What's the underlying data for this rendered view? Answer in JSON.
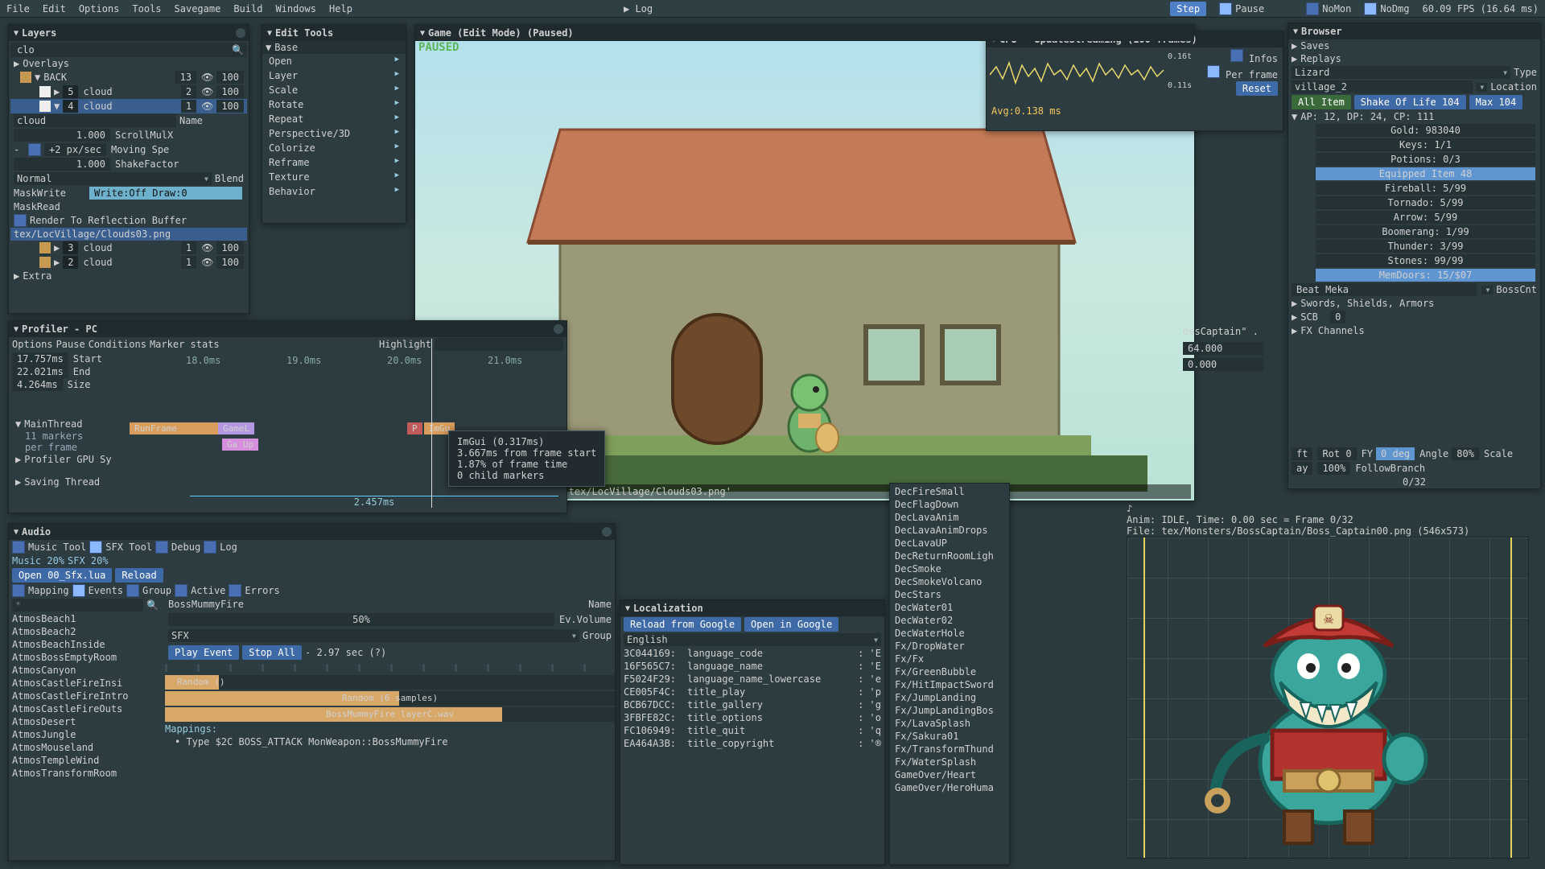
{
  "menubar": {
    "items": [
      "File",
      "Edit",
      "Options",
      "Tools",
      "Savegame",
      "Build",
      "Windows",
      "Help"
    ],
    "log": "Log",
    "step": "Step",
    "pause": "Pause",
    "nomon": "NoMon",
    "nodmg": "NoDmg",
    "fps": "60.09 FPS (16.64 ms)"
  },
  "layers": {
    "title": "Layers",
    "search": "clo",
    "overlays": "Overlays",
    "back": "BACK",
    "back_n": "13",
    "back_v": "100",
    "rows": [
      {
        "n": "5",
        "name": "cloud",
        "a": "2",
        "v": "100"
      },
      {
        "n": "4",
        "name": "cloud",
        "a": "1",
        "v": "100"
      }
    ],
    "picked": "cloud",
    "nameh": "Name",
    "sx_v": "1.000",
    "sx_l": "ScrollMulX",
    "spd_v": "+2 px/sec",
    "spd_l": "Moving Spe",
    "sk_v": "1.000",
    "sk_l": "ShakeFactor",
    "blend_mode": "Normal",
    "blend_l": "Blend",
    "maskw": "MaskWrite",
    "maskw_v": "Write:Off Draw:0",
    "maskr": "MaskRead",
    "reflect": "Render To Reflection Buffer",
    "path": "tex/LocVillage/Clouds03.png",
    "rows2": [
      {
        "n": "3",
        "name": "cloud",
        "a": "1",
        "v": "100"
      },
      {
        "n": "2",
        "name": "cloud",
        "a": "1",
        "v": "100"
      }
    ],
    "extra": "Extra"
  },
  "edit_tools": {
    "title": "Edit Tools",
    "base": "Base",
    "items": [
      "Open",
      "Layer",
      "Scale",
      "Rotate",
      "Repeat",
      "Perspective/3D",
      "Colorize",
      "Reframe",
      "Texture",
      "Behavior"
    ]
  },
  "game": {
    "title": "Game (Edit Mode) (Paused)",
    "paused": "PAUSED",
    "status": "Select layer:BG layer 4 'tex/LocVillage/Clouds03.png'"
  },
  "cpu": {
    "title": "CPU - UpdateStreaming (100 frames)",
    "t0": "0.16t",
    "t1": "0.11s",
    "infos": "Infos",
    "perframe": "Per frame",
    "reset": "Reset",
    "avg": "Avg:0.138 ms"
  },
  "profiler": {
    "title": "Profiler - PC",
    "menu": [
      "Options",
      "Pause",
      "Conditions",
      "Marker stats"
    ],
    "hl": "Highlight",
    "start_v": "17.757ms",
    "start_l": "Start",
    "end_v": "22.021ms",
    "end_l": "End",
    "size_v": "4.264ms",
    "size_l": "Size",
    "ticks": [
      "18.0ms",
      "19.0ms",
      "20.0ms",
      "21.0ms"
    ],
    "main": "MainThread",
    "main_sub": "11 markers\nper frame",
    "gpu": "Profiler GPU Sy",
    "saving": "Saving Thread",
    "bars": [
      "RunFrame",
      "GameL",
      "Ga Up",
      "P",
      "ImGu"
    ],
    "ruler": "2.457ms",
    "tooltip": [
      "ImGui (0.317ms)",
      "3.667ms from frame start",
      "1.87% of frame time",
      "0 child markers"
    ]
  },
  "audio": {
    "title": "Audio",
    "tabs": [
      "Music Tool",
      "SFX Tool",
      "Debug",
      "Log"
    ],
    "music": "Music 20%",
    "sfx": "SFX 20%",
    "open": "Open 00_Sfx.lua",
    "reload": "Reload",
    "filters": [
      "Mapping",
      "Events",
      "Group",
      "Active",
      "Errors"
    ],
    "search_ph": "*",
    "namecol": "Name",
    "name": "BossMummyFire",
    "fifty": "50%",
    "evvol": "Ev.Volume",
    "sfx_lbl": "SFX",
    "group": "Group",
    "play": "Play Event",
    "stop": "Stop All",
    "dur": "- 2.97 sec (?)",
    "rand": "Random ()",
    "rand2": "Random (6 samples)",
    "wav": "BossMummyFire layerC.wav",
    "mappings": "Mappings:",
    "map1": "• Type $2C BOSS_ATTACK    MonWeapon::BossMummyFire",
    "list": [
      "AtmosBeach1",
      "AtmosBeach2",
      "AtmosBeachInside",
      "AtmosBossEmptyRoom",
      "AtmosCanyon",
      "AtmosCastleFireInsi",
      "AtmosCastleFireIntro",
      "AtmosCastleFireOuts",
      "AtmosDesert",
      "AtmosJungle",
      "AtmosMouseland",
      "AtmosTempleWind",
      "AtmosTransformRoom"
    ]
  },
  "loc": {
    "title": "Localization",
    "reload": "Reload from Google",
    "open": "Open in Google",
    "lang": "English",
    "rows": [
      [
        "3C044169:",
        "language_code",
        ": 'E"
      ],
      [
        "16F565C7:",
        "language_name",
        ": 'E"
      ],
      [
        "F5024F29:",
        "language_name_lowercase",
        ": 'e"
      ],
      [
        "CE005F4C:",
        "title_play",
        ": 'p"
      ],
      [
        "BCB67DCC:",
        "title_gallery",
        ": 'g"
      ],
      [
        "3FBFE82C:",
        "title_options",
        ": 'o"
      ],
      [
        "FC106949:",
        "title_quit",
        ": 'q"
      ],
      [
        "EA464A3B:",
        "title_copyright",
        ": '®"
      ]
    ]
  },
  "fxlist": [
    "DecFireSmall",
    "DecFlagDown",
    "DecLavaAnim",
    "DecLavaAnimDrops",
    "DecLavaUP",
    "DecReturnRoomLigh",
    "DecSmoke",
    "DecSmokeVolcano",
    "DecStars",
    "DecWater01",
    "DecWater02",
    "DecWaterHole",
    "Fx/DropWater",
    "Fx/Fx",
    "Fx/GreenBubble",
    "Fx/HitImpactSword",
    "Fx/JumpLanding",
    "Fx/JumpLandingBos",
    "Fx/LavaSplash",
    "Fx/Sakura01",
    "Fx/TransformThund",
    "Fx/WaterSplash",
    "GameOver/Heart",
    "GameOver/HeroHuma"
  ],
  "browser": {
    "title": "Browser",
    "saves": "Saves",
    "replays": "Replays",
    "entity": "Lizard",
    "type": "Type",
    "loc": "village_2",
    "locl": "Location",
    "allitem": "All Item",
    "shake": "Shake Of Life 104",
    "max": "Max 104",
    "stats": "AP: 12, DP: 24, CP: 111",
    "props": [
      "Gold: 983040",
      "Keys: 1/1",
      "Potions: 0/3",
      "Equipped Item 48",
      "Fireball: 5/99",
      "Tornado: 5/99",
      "Arrow: 5/99",
      "Boomerang: 1/99",
      "Thunder: 3/99",
      "Stones: 99/99",
      "MemDoors: 15/$07"
    ],
    "beat": "Beat Meka",
    "bosscnt": "BossCnt",
    "swords": "Swords, Shields, Armors",
    "scb": "SCB",
    "scb_v": "0",
    "fxch": "FX Channels",
    "ft": "ft",
    "rot": "Rot 0",
    "fy": "FY",
    "deg": "0 deg",
    "angle": "Angle",
    "pct": "80%",
    "scale": "Scale",
    "ay": "ay",
    "hundred": "100%",
    "follow": "FollowBranch",
    "zero32": "0/32",
    "animline": "Anim: IDLE, Time:  0.00 sec = Frame 0/32",
    "fileline": "File: tex/Monsters/BossCaptain/Boss_Captain00.png (546x573)",
    "boss": "ossCaptain\" .",
    "b2": "64.000",
    "b3": "0.000"
  }
}
